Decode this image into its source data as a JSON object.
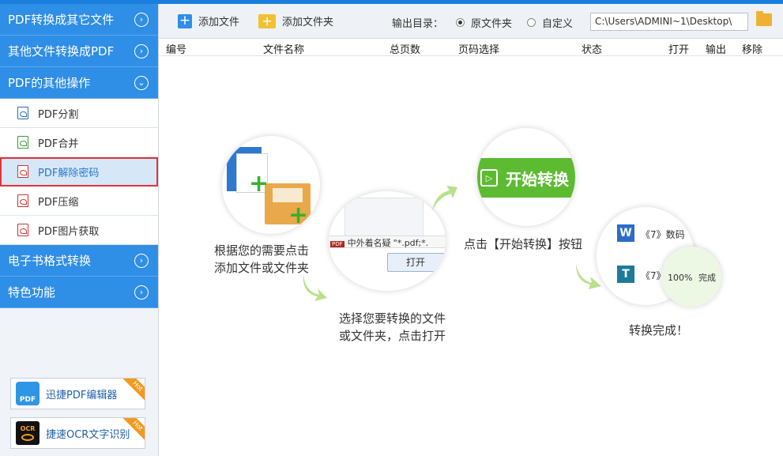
{
  "sidebar": {
    "categories": [
      {
        "label": "PDF转换成其它文件",
        "chevron": "›"
      },
      {
        "label": "其他文件转换成PDF",
        "chevron": "›"
      },
      {
        "label": "PDF的其他操作",
        "chevron": "⌄"
      }
    ],
    "sub_items": [
      {
        "label": "PDF分割"
      },
      {
        "label": "PDF合并"
      },
      {
        "label": "PDF解除密码"
      },
      {
        "label": "PDF压缩"
      },
      {
        "label": "PDF图片获取"
      }
    ],
    "categories_after": [
      {
        "label": "电子书格式转换",
        "chevron": "›"
      },
      {
        "label": "特色功能",
        "chevron": "›"
      }
    ],
    "promos": [
      {
        "label": "迅捷PDF编辑器",
        "badge": "Hot",
        "logo_text": "PDF"
      },
      {
        "label": "捷速OCR文字识别",
        "badge": "Hot",
        "logo_text": "OCR"
      }
    ]
  },
  "toolbar": {
    "add_file": "添加文件",
    "add_folder": "添加文件夹",
    "output_label": "输出目录：",
    "option_original": "原文件夹",
    "option_custom": "自定义",
    "path": "C:\\Users\\ADMINI~1\\Desktop\\"
  },
  "columns": [
    "编号",
    "文件名称",
    "总页数",
    "页码选择",
    "状态",
    "打开",
    "输出",
    "移除"
  ],
  "steps": {
    "step1": [
      "根据您的需要点击",
      "添加文件或文件夹"
    ],
    "step2": [
      "选择您要转换的文件",
      "或文件夹，点击打开"
    ],
    "step3": "点击【开始转换】按钮",
    "step4": "转换完成！",
    "dialog_file": "中外着名疑",
    "dialog_filter": "\"*.pdf;*.",
    "dialog_open": "打开",
    "start_button": "开始转换",
    "result_row1": "《7》数码",
    "result_row2": "《7》",
    "progress": "100%",
    "progress_done": "完成"
  },
  "colors": {
    "accent": "#2f8ee6",
    "green": "#5dbb32",
    "highlight_border": "#e0343c"
  }
}
